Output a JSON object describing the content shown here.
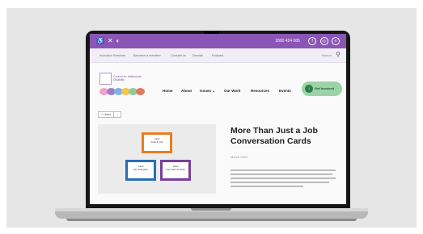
{
  "topbar": {
    "phone": "1800 424 065",
    "icons": [
      "accessibility-icon",
      "close-icon",
      "contrast-icon"
    ],
    "social_icons": [
      "facebook-icon",
      "instagram-icon",
      "menu-icon"
    ],
    "color": "#8a56b5"
  },
  "subnav": {
    "items": [
      "Inclusion Services",
      "Become a member",
      "Contact us",
      "Donate",
      "Podcast"
    ],
    "search_label": "Search",
    "search_glyph": "⚲"
  },
  "logo": {
    "text": "Council for Intellectual Disability",
    "arc_colors": [
      "#f4a3c8",
      "#9e7cc8",
      "#7fb3e0",
      "#f6c34c",
      "#8ccf9a",
      "#e07a5f"
    ]
  },
  "mainnav": {
    "items": [
      "Home",
      "About",
      "Issues ⌄",
      "Our Work",
      "Resources",
      "Events"
    ],
    "cta_label": "Get Involved",
    "cta_color": "#9bd3a7"
  },
  "breadcrumb": {
    "home": "⌂ Home",
    "sep": "›"
  },
  "hero": {
    "cards": [
      {
        "text": "Card\nJobs & Life",
        "color": "#e67e22"
      },
      {
        "text": "Card\nMy Strengths",
        "color": "#2a6db5"
      },
      {
        "text": "Card\nImportant at Work",
        "color": "#7a3f9b"
      }
    ]
  },
  "article": {
    "title": "More Than Just a Job Conversation Cards",
    "date": "March 2024"
  }
}
